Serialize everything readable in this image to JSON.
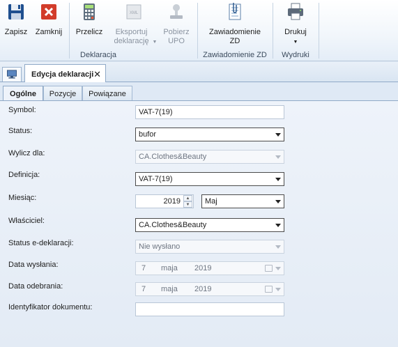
{
  "ribbon": {
    "declaration_group": {
      "label": "Deklaracja",
      "save": "Zapisz",
      "close": "Zamknij",
      "recalc": "Przelicz",
      "export": "Eksportuj deklarację",
      "fetch_upo": "Pobierz UPO"
    },
    "zd_group": {
      "label": "Zawiadomienie ZD",
      "zd_button": "Zawiadomienie ZD"
    },
    "print_group": {
      "label": "Wydruki",
      "print_button": "Drukuj"
    }
  },
  "doc_tab": {
    "title": "Edycja deklaracji",
    "close_glyph": "✕"
  },
  "tabs": [
    "Ogólne",
    "Pozycje",
    "Powiązane"
  ],
  "form": {
    "symbol": {
      "label": "Symbol:",
      "value": "VAT-7(19)"
    },
    "status": {
      "label": "Status:",
      "value": "bufor"
    },
    "compute_for": {
      "label": "Wylicz dla:",
      "value": "CA.Clothes&Beauty"
    },
    "definition": {
      "label": "Definicja:",
      "value": "VAT-7(19)"
    },
    "month": {
      "label": "Miesiąc:",
      "year": "2019",
      "month": "Maj"
    },
    "owner": {
      "label": "Właściciel:",
      "value": "CA.Clothes&Beauty"
    },
    "edecl_status": {
      "label": "Status e-deklaracji:",
      "value": "Nie wysłano"
    },
    "sent_date": {
      "label": "Data wysłania:",
      "day": "7",
      "month": "maja",
      "year": "2019"
    },
    "received_date": {
      "label": "Data odebrania:",
      "day": "7",
      "month": "maja",
      "year": "2019"
    },
    "doc_id": {
      "label": "Identyfikator dokumentu:",
      "value": ""
    }
  },
  "colors": {
    "ribbon_bg": "#f1f6fb",
    "panel_bg": "#e3ebf5",
    "save_icon": "#1f4f8f",
    "close_icon": "#d23c2a"
  }
}
